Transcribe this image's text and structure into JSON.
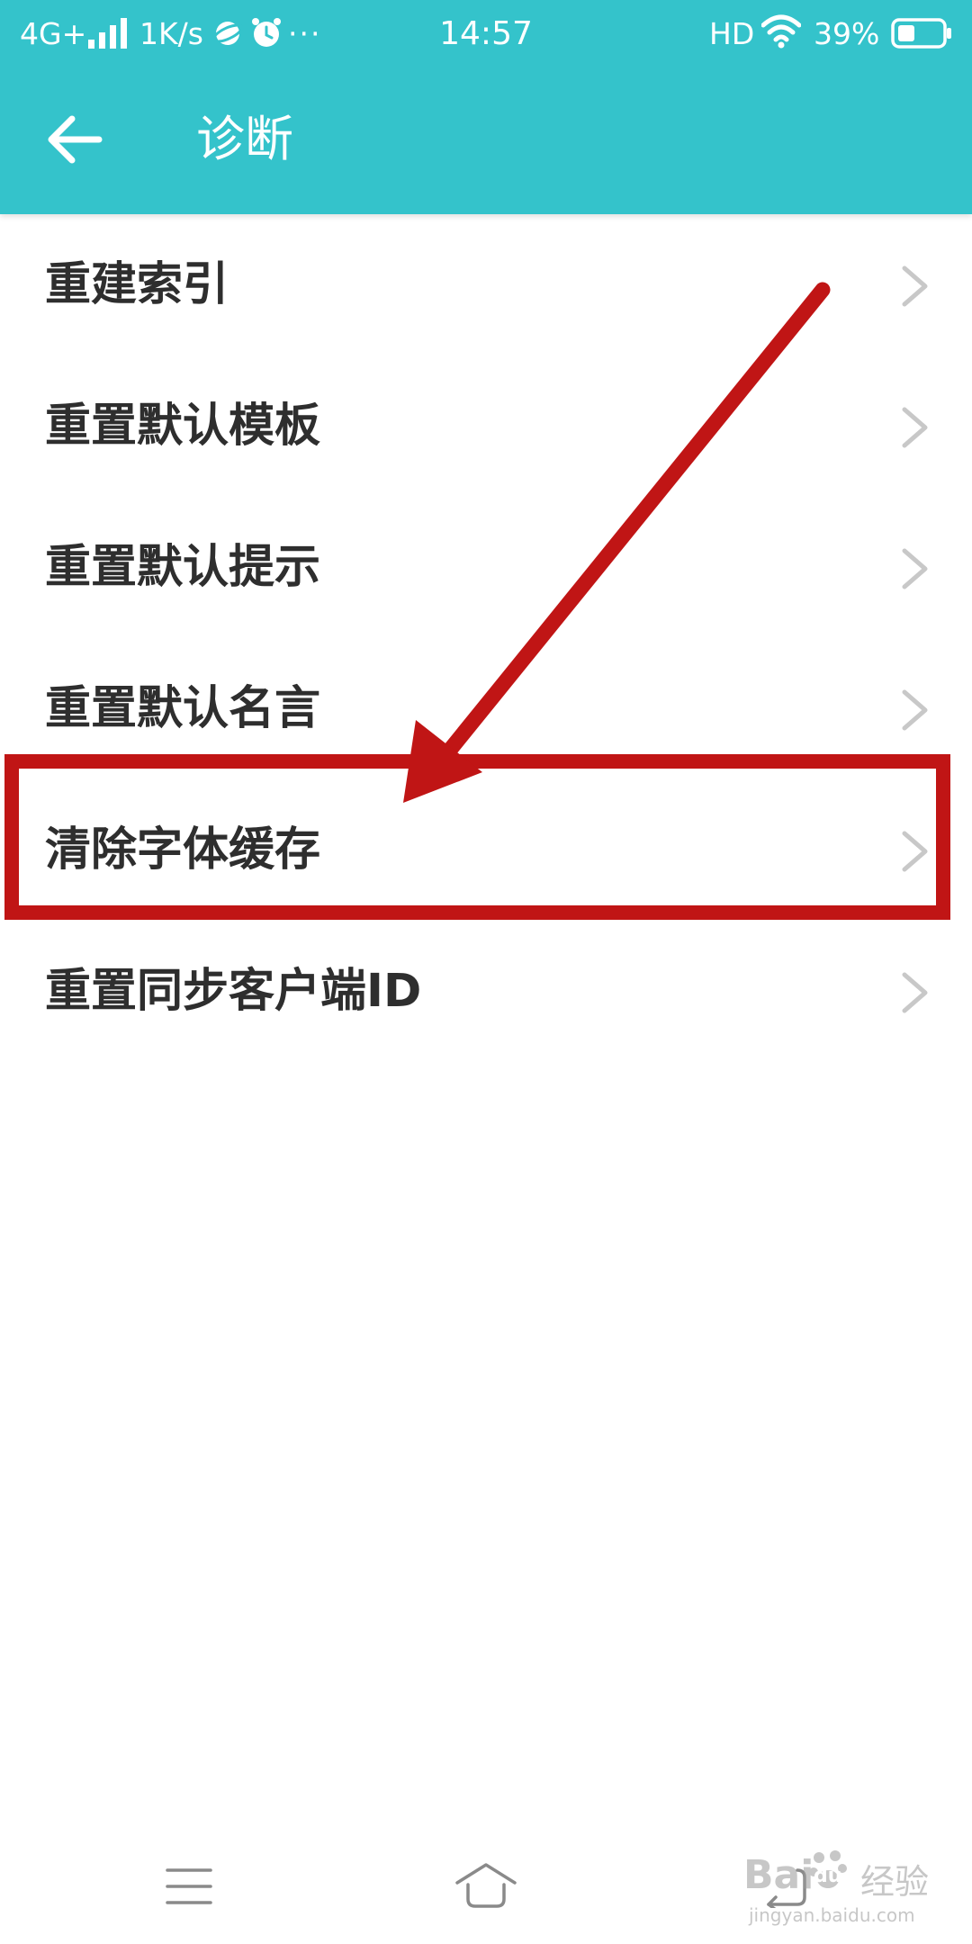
{
  "status_bar": {
    "network": "4G+",
    "speed": "1K/s",
    "more": "···",
    "time": "14:57",
    "hd": "HD",
    "battery": "39%",
    "icons": [
      "signal-icon",
      "planet-icon",
      "alarm-icon",
      "wifi-icon",
      "battery-icon"
    ]
  },
  "toolbar": {
    "title": "诊断",
    "back_icon": "arrow-left-icon"
  },
  "menu": {
    "items": [
      {
        "label": "重建索引"
      },
      {
        "label": "重置默认模板"
      },
      {
        "label": "重置默认提示"
      },
      {
        "label": "重置默认名言"
      },
      {
        "label": "清除字体缓存"
      },
      {
        "label": "重置同步客户端ID"
      }
    ],
    "chevron_icon": "chevron-right-icon",
    "highlighted_index": 4
  },
  "annotation": {
    "color": "#c01515",
    "type": "arrow-and-box"
  },
  "nav_bar": {
    "icons": [
      "menu-icon",
      "home-icon",
      "back-icon"
    ]
  },
  "watermark": {
    "brand": "Bai",
    "du": "du",
    "label": "经验",
    "url": "jingyan.baidu.com"
  },
  "colors": {
    "header": "#34c3cb",
    "text": "#2e2e2e",
    "chevron": "#c8c8c8"
  }
}
